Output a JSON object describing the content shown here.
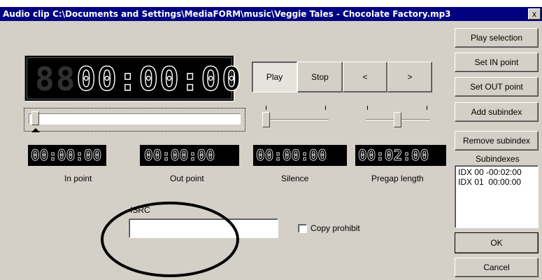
{
  "window": {
    "title": "Audio clip C:\\Documents and Settings\\MediaFORM\\music\\Veggie Tales - Chocolate Factory.mp3",
    "close_glyph": "x"
  },
  "display": {
    "main_time_ghost": "88",
    "main_time": "00:00:00",
    "small_timers": [
      {
        "value": "00:00:00",
        "label": "In point"
      },
      {
        "value": "00:00:00",
        "label": "Out point"
      },
      {
        "value": "00:00:00",
        "label": "Silence"
      },
      {
        "value": "00:02:00",
        "label": "Pregap length"
      }
    ]
  },
  "transport": {
    "play": "Play",
    "stop": "Stop",
    "prev": "<",
    "next": ">"
  },
  "side_buttons": {
    "play_selection": "Play selection",
    "set_in": "Set IN point",
    "set_out": "Set OUT point",
    "add_subindex": "Add subindex",
    "remove_subindex": "Remove subindex",
    "ok": "OK",
    "cancel": "Cancel"
  },
  "subindexes": {
    "label": "Subindexes",
    "items": [
      "IDX 00 -00:02:00",
      "IDX 01  00:00:00"
    ]
  },
  "isrc": {
    "label": "ISRC",
    "value": ""
  },
  "copy_prohibit": {
    "label": "Copy prohibit",
    "checked": false
  },
  "sliders": {
    "position": 0,
    "volume": 0,
    "balance": 0.5
  }
}
